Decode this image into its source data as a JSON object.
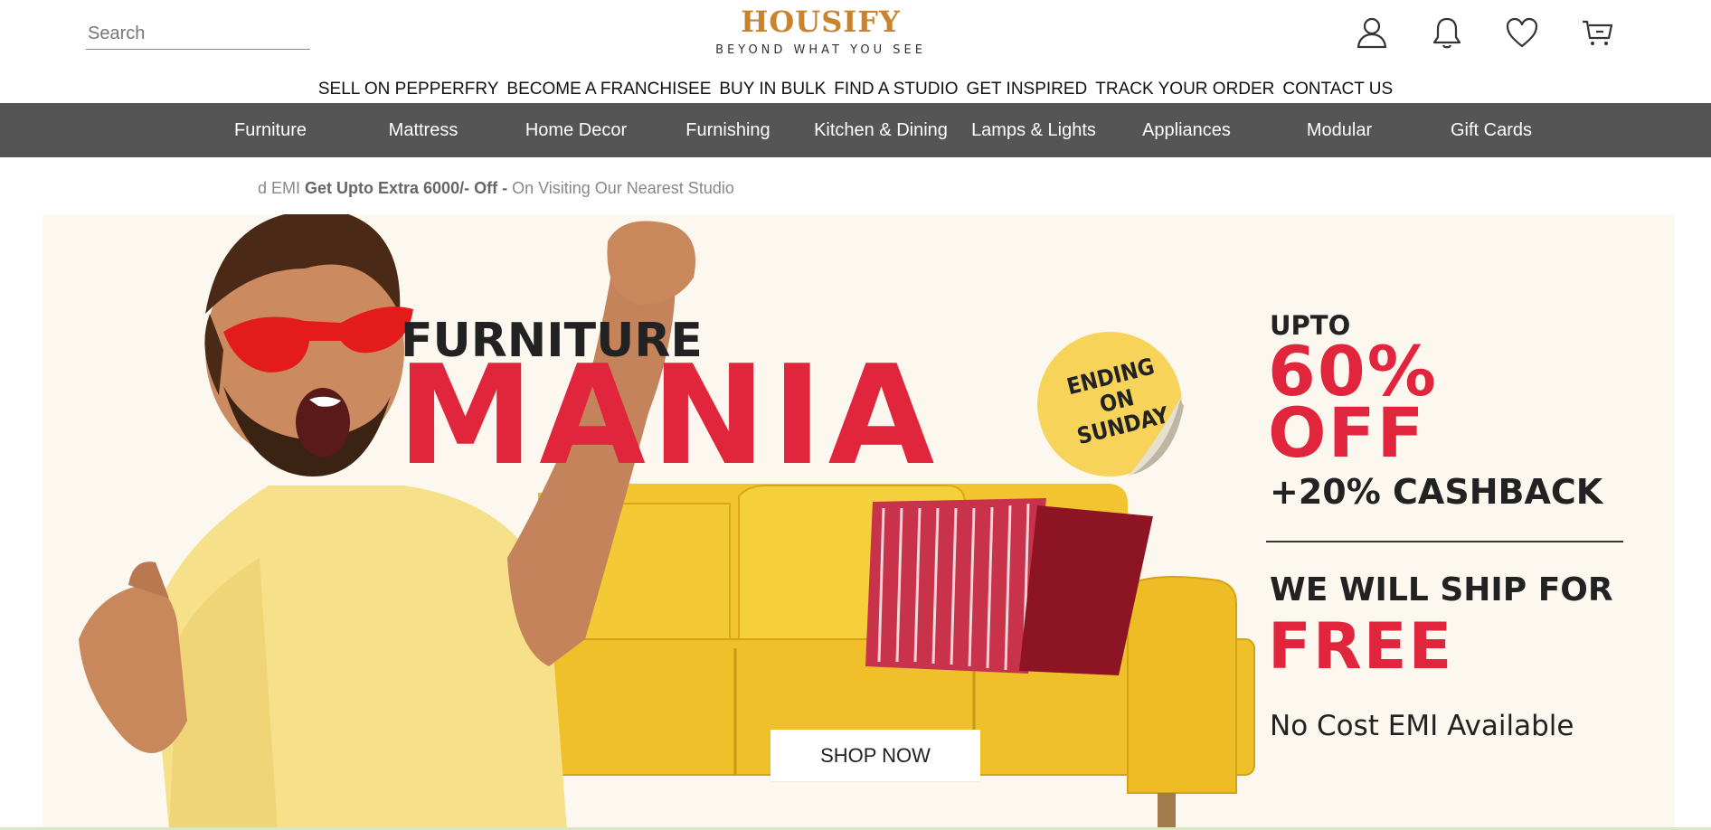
{
  "header": {
    "search_placeholder": "Search",
    "logo_title": "HOUSIFY",
    "logo_tagline": "BEYOND WHAT YOU SEE",
    "icons": [
      "user-icon",
      "bell-icon",
      "heart-icon",
      "cart-icon"
    ]
  },
  "utility_links": [
    "SELL ON PEPPERFRY",
    "BECOME A FRANCHISEE",
    "BUY IN BULK",
    "FIND A STUDIO",
    "GET INSPIRED",
    "TRACK YOUR ORDER",
    "CONTACT US"
  ],
  "categories": [
    "Furniture",
    "Mattress",
    "Home Decor",
    "Furnishing",
    "Kitchen & Dining",
    "Lamps & Lights",
    "Appliances",
    "Modular",
    "Gift Cards"
  ],
  "promo_strip": {
    "prefix": "d EMI ",
    "bold": "Get Upto Extra 6000/- Off - ",
    "suffix": "On Visiting Our Nearest Studio"
  },
  "hero": {
    "furniture": "FURNITURE",
    "mania": "MANIA",
    "sticker_line1": "ENDING ON",
    "sticker_line2": "SUNDAY",
    "upto": "UPTO",
    "percent": "60%",
    "off": "OFF",
    "cashback": "+20% CASHBACK",
    "ship": "WE WILL SHIP FOR",
    "free": "FREE",
    "emi": "No Cost EMI Available",
    "shop_now": "SHOP NOW"
  },
  "colors": {
    "brand": "#c9822e",
    "nav_bg": "#555555",
    "accent_red": "#e0253c",
    "hero_bg": "#fdf8ef",
    "sofa_yellow": "#f2c530",
    "sticker_yellow": "#f7d35a"
  }
}
